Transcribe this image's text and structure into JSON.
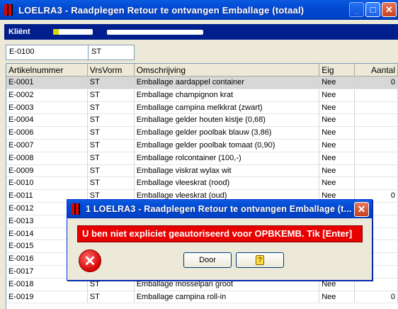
{
  "window": {
    "title": "LOELRA3 - Raadplegen Retour te ontvangen Emballage (totaal)",
    "min_label": "_",
    "max_label": "□",
    "close_label": "✕"
  },
  "client": {
    "label": "Kliënt"
  },
  "filter": {
    "code": "E-0100",
    "vorm": "ST"
  },
  "table": {
    "headers": [
      "Artikelnummer",
      "VrsVorm",
      "Omschrijving",
      "Eig",
      "Aantal"
    ],
    "rows": [
      [
        "E-0001",
        "ST",
        "Emballage aardappel container",
        "Nee",
        "0"
      ],
      [
        "E-0002",
        "ST",
        "Emballage champignon krat",
        "Nee",
        ""
      ],
      [
        "E-0003",
        "ST",
        "Emballage campina melkkrat (zwart)",
        "Nee",
        ""
      ],
      [
        "E-0004",
        "ST",
        "Emballage gelder houten kistje (0,68)",
        "Nee",
        ""
      ],
      [
        "E-0006",
        "ST",
        "Emballage gelder poolbak blauw (3,86)",
        "Nee",
        ""
      ],
      [
        "E-0007",
        "ST",
        "Emballage gelder poolbak tomaat (0,90)",
        "Nee",
        ""
      ],
      [
        "E-0008",
        "ST",
        "Emballage rolcontainer (100,-)",
        "Nee",
        ""
      ],
      [
        "E-0009",
        "ST",
        "Emballage viskrat wylax wit",
        "Nee",
        ""
      ],
      [
        "E-0010",
        "ST",
        "Emballage vleeskrat (rood)",
        "Nee",
        ""
      ],
      [
        "E-0011",
        "ST",
        "Emballage vleeskrat (oud)",
        "Nee",
        "0"
      ],
      [
        "E-0012",
        "",
        "",
        "",
        ""
      ],
      [
        "E-0013",
        "",
        "",
        "",
        ""
      ],
      [
        "E-0014",
        "",
        "",
        "",
        ""
      ],
      [
        "E-0015",
        "",
        "",
        "",
        ""
      ],
      [
        "E-0016",
        "",
        "",
        "",
        ""
      ],
      [
        "E-0017",
        "",
        "",
        "",
        ""
      ],
      [
        "E-0018",
        "ST",
        "Emballage mosselpan groot",
        "Nee",
        ""
      ],
      [
        "E-0019",
        "ST",
        "Emballage campina roll-in",
        "Nee",
        "0"
      ]
    ]
  },
  "dialog": {
    "title": "1 LOELRA3 - Raadplegen Retour te ontvangen Emballage (t...",
    "message": "U ben niet expliciet geautoriseerd voor OPBKEMB. Tik [Enter]",
    "door_label": "Door",
    "help_label": "?",
    "error_icon_label": "✕",
    "close_label": "✕"
  }
}
